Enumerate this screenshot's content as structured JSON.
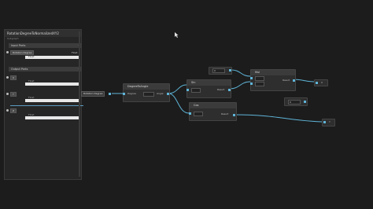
{
  "panel": {
    "title": "RotationDegreeToNormalizedXY2",
    "subtitle": "Subgraph",
    "input_section": "Input Ports",
    "output_section": "Output Ports",
    "float_label": "Float",
    "value_label": "Float",
    "port_name_input": "Rotation Degree",
    "output_ports": [
      "X",
      "Y",
      "Z"
    ]
  },
  "nodes": {
    "input_chip": "Rotation Degree",
    "degree_to_angle": {
      "title": "DegreeToAngle",
      "in": "Degree",
      "out": "Angle"
    },
    "sin": {
      "title": "Sin",
      "out": "Result"
    },
    "mul": {
      "title": "Mul",
      "out": "Result"
    },
    "cos": {
      "title": "Cos",
      "out": "Result"
    },
    "const_a": "0",
    "const_b": "0",
    "out_x": "X",
    "out_y": "Y"
  },
  "colors": {
    "wire": "#5fb5d8",
    "accent": "#5fb5d8"
  }
}
